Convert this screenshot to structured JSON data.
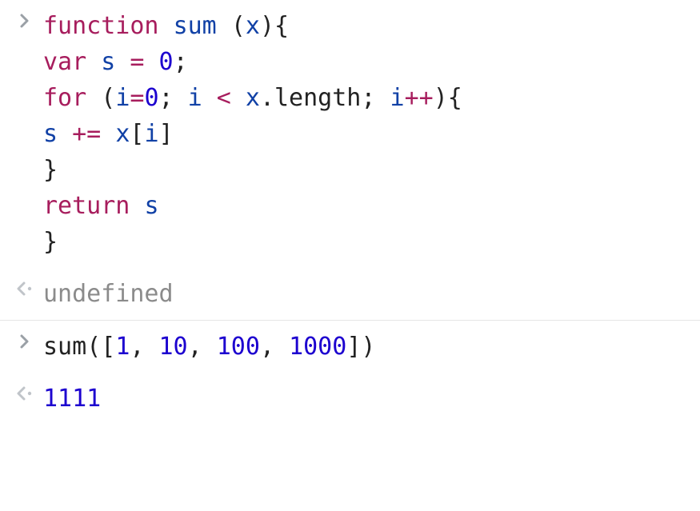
{
  "entries": [
    {
      "kind": "input",
      "tokens": [
        {
          "t": "function",
          "c": "kw"
        },
        {
          "t": " ",
          "c": "plain"
        },
        {
          "t": "sum",
          "c": "fn"
        },
        {
          "t": " ",
          "c": "plain"
        },
        {
          "t": "(",
          "c": "paren"
        },
        {
          "t": "x",
          "c": "var"
        },
        {
          "t": ")",
          "c": "paren"
        },
        {
          "t": "{",
          "c": "paren"
        },
        {
          "t": "\n",
          "c": "plain"
        },
        {
          "t": "var",
          "c": "kw"
        },
        {
          "t": " ",
          "c": "plain"
        },
        {
          "t": "s",
          "c": "var"
        },
        {
          "t": " ",
          "c": "plain"
        },
        {
          "t": "=",
          "c": "op"
        },
        {
          "t": " ",
          "c": "plain"
        },
        {
          "t": "0",
          "c": "num"
        },
        {
          "t": ";",
          "c": "plain"
        },
        {
          "t": "\n",
          "c": "plain"
        },
        {
          "t": "for",
          "c": "kw"
        },
        {
          "t": " ",
          "c": "plain"
        },
        {
          "t": "(",
          "c": "paren"
        },
        {
          "t": "i",
          "c": "var"
        },
        {
          "t": "=",
          "c": "op"
        },
        {
          "t": "0",
          "c": "num"
        },
        {
          "t": ";",
          "c": "plain"
        },
        {
          "t": " ",
          "c": "plain"
        },
        {
          "t": "i",
          "c": "var"
        },
        {
          "t": " ",
          "c": "plain"
        },
        {
          "t": "<",
          "c": "op"
        },
        {
          "t": " ",
          "c": "plain"
        },
        {
          "t": "x",
          "c": "var"
        },
        {
          "t": ".",
          "c": "plain"
        },
        {
          "t": "length",
          "c": "prop"
        },
        {
          "t": ";",
          "c": "plain"
        },
        {
          "t": " ",
          "c": "plain"
        },
        {
          "t": "i",
          "c": "var"
        },
        {
          "t": "++",
          "c": "op"
        },
        {
          "t": ")",
          "c": "paren"
        },
        {
          "t": "{",
          "c": "paren"
        },
        {
          "t": "\n",
          "c": "plain"
        },
        {
          "t": "s",
          "c": "var"
        },
        {
          "t": " ",
          "c": "plain"
        },
        {
          "t": "+=",
          "c": "op"
        },
        {
          "t": " ",
          "c": "plain"
        },
        {
          "t": "x",
          "c": "var"
        },
        {
          "t": "[",
          "c": "paren"
        },
        {
          "t": "i",
          "c": "var"
        },
        {
          "t": "]",
          "c": "paren"
        },
        {
          "t": "\n",
          "c": "plain"
        },
        {
          "t": "}",
          "c": "paren"
        },
        {
          "t": "\n",
          "c": "plain"
        },
        {
          "t": "return",
          "c": "kw"
        },
        {
          "t": " ",
          "c": "plain"
        },
        {
          "t": "s",
          "c": "var"
        },
        {
          "t": "\n",
          "c": "plain"
        },
        {
          "t": "}",
          "c": "paren"
        }
      ]
    },
    {
      "kind": "output",
      "text": "undefined",
      "dim": true
    },
    {
      "kind": "input",
      "sep": true,
      "tokens": [
        {
          "t": "sum",
          "c": "plain"
        },
        {
          "t": "(",
          "c": "paren"
        },
        {
          "t": "[",
          "c": "paren"
        },
        {
          "t": "1",
          "c": "num"
        },
        {
          "t": ",",
          "c": "plain"
        },
        {
          "t": " ",
          "c": "plain"
        },
        {
          "t": "10",
          "c": "num"
        },
        {
          "t": ",",
          "c": "plain"
        },
        {
          "t": " ",
          "c": "plain"
        },
        {
          "t": "100",
          "c": "num"
        },
        {
          "t": ",",
          "c": "plain"
        },
        {
          "t": " ",
          "c": "plain"
        },
        {
          "t": "1000",
          "c": "num"
        },
        {
          "t": "]",
          "c": "paren"
        },
        {
          "t": ")",
          "c": "paren"
        }
      ]
    },
    {
      "kind": "output",
      "tokens": [
        {
          "t": "1111",
          "c": "num"
        }
      ]
    }
  ],
  "icons": {
    "input_color": "#9aa0a6",
    "output_color": "#c0c4c9"
  }
}
